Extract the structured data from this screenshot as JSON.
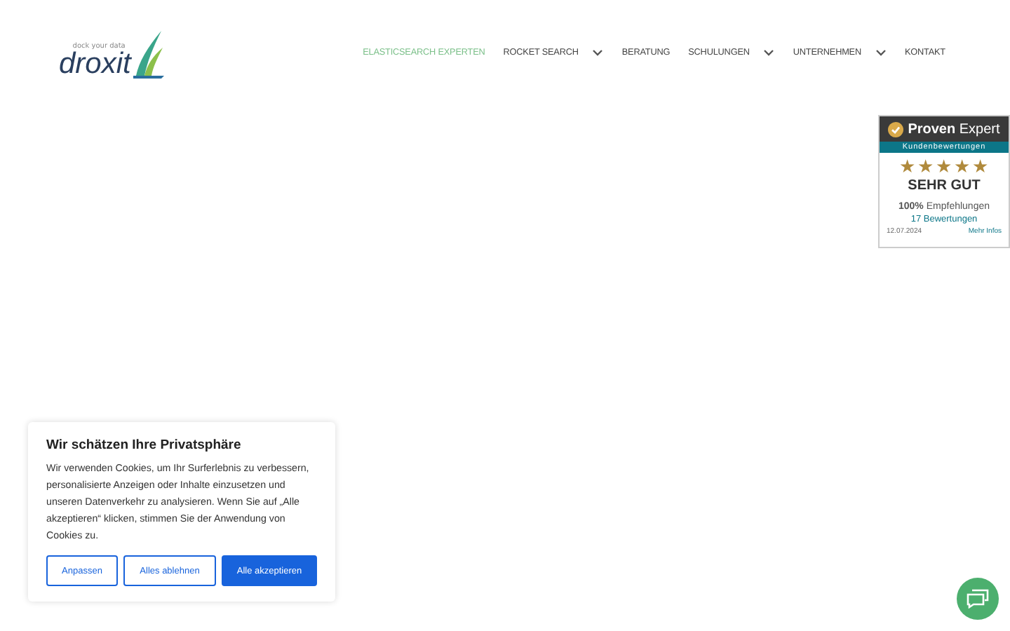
{
  "logo": {
    "tagline": "dock your data",
    "name": "droxit"
  },
  "nav": [
    {
      "label": "ELASTICSEARCH EXPERTEN",
      "selected": true,
      "dropdown": false
    },
    {
      "label": "ROCKET SEARCH",
      "selected": false,
      "dropdown": true
    },
    {
      "label": "BERATUNG",
      "selected": false,
      "dropdown": false
    },
    {
      "label": "SCHULUNGEN",
      "selected": false,
      "dropdown": true
    },
    {
      "label": "UNTERNEHMEN",
      "selected": false,
      "dropdown": true
    },
    {
      "label": "KONTAKT",
      "selected": false,
      "dropdown": false
    }
  ],
  "rating_badge": {
    "brand_bold": "Proven",
    "brand_light": "Expert",
    "subtitle": "Kundenbewertungen",
    "stars": 5,
    "grade": "SEHR GUT",
    "recommend_pct": "100%",
    "recommend_label": "Empfehlungen",
    "reviews": "17 Bewertungen",
    "date": "12.07.2024",
    "more": "Mehr Infos"
  },
  "cookie_banner": {
    "title": "Wir schätzen Ihre Privatsphäre",
    "text": "Wir verwenden Cookies, um Ihr Surferlebnis zu verbessern, personalisierte Anzeigen oder Inhalte einzusetzen und unseren Datenverkehr zu analysieren. Wenn Sie auf „Alle akzeptieren“ klicken, stimmen Sie der Anwendung von Cookies zu.",
    "buttons": [
      {
        "label": "Anpassen",
        "kind": "outline"
      },
      {
        "label": "Alles ablehnen",
        "kind": "outline"
      },
      {
        "label": "Alle akzeptieren",
        "kind": "primary"
      }
    ]
  }
}
